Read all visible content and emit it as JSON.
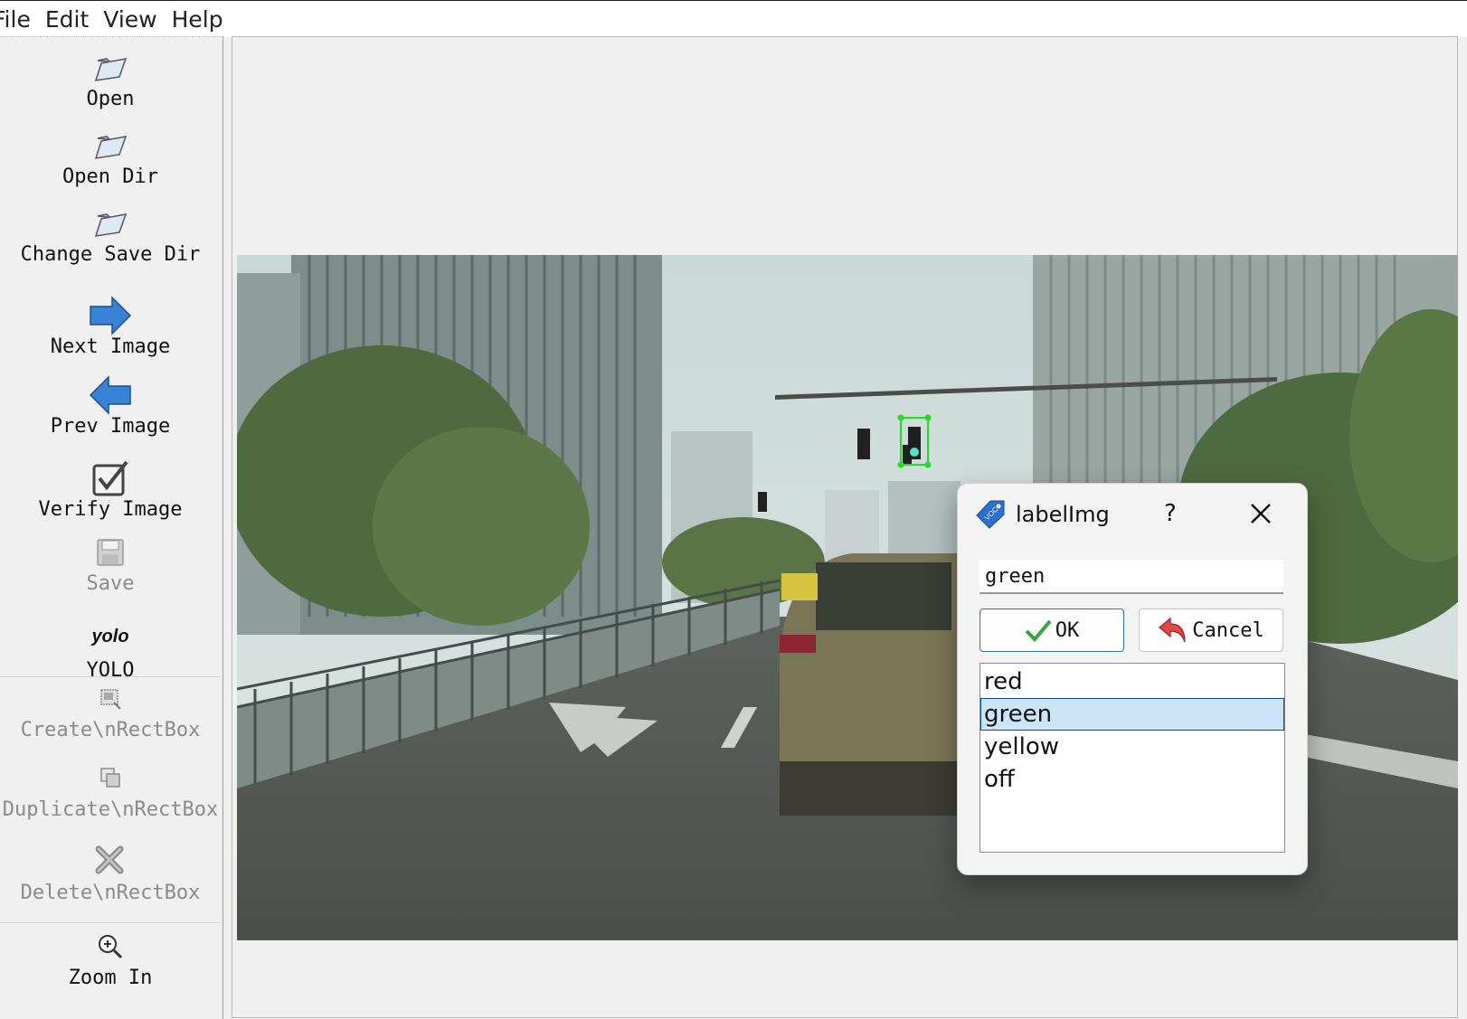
{
  "menu": [
    "File",
    "Edit",
    "View",
    "Help"
  ],
  "toolbar": {
    "open": "Open",
    "open_dir": "Open Dir",
    "change_save_dir": "Change Save Dir",
    "next_image": "Next Image",
    "prev_image": "Prev Image",
    "verify_image": "Verify Image",
    "save": "Save",
    "yolo_icon_text": "yolo",
    "yolo": "YOLO",
    "create_rectbox": "Create\\nRectBox",
    "duplicate_rectbox": "Duplicate\\nRectBox",
    "delete_rectbox": "Delete\\nRectBox",
    "zoom_in": "Zoom In"
  },
  "icons": {
    "open": "folder-icon",
    "open_dir": "folder-icon",
    "change_save_dir": "folder-icon",
    "next_image": "arrow-right-icon",
    "prev_image": "arrow-left-icon",
    "verify_image": "checkbox-icon",
    "save": "floppy-icon",
    "create_rectbox": "create-box-icon",
    "duplicate_rectbox": "duplicate-icon",
    "delete_rectbox": "delete-icon",
    "zoom_in": "zoom-in-icon"
  },
  "dialog": {
    "title": "labelImg",
    "help": "?",
    "input_value": "green",
    "ok_label": "OK",
    "cancel_label": "Cancel",
    "labels": [
      "red",
      "green",
      "yellow",
      "off"
    ],
    "selected_index": 1
  },
  "colors": {
    "selection_bg": "#cce4f7",
    "bbox_green": "#22dd22",
    "arrow_blue": "#3a82d6",
    "ok_border": "#2a74c8"
  }
}
